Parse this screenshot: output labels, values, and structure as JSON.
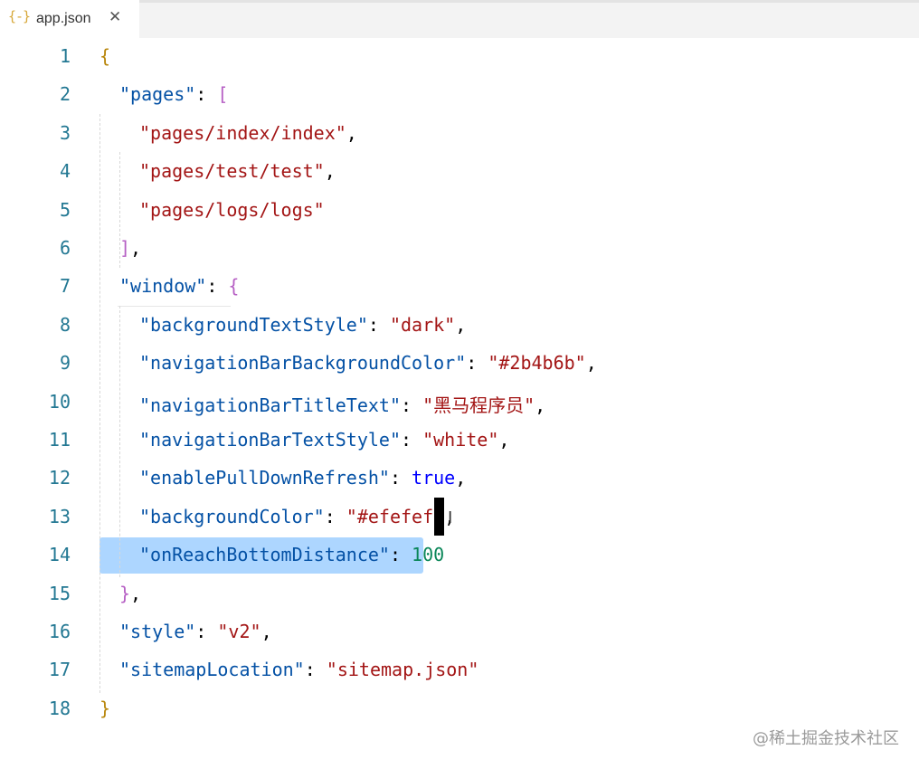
{
  "tab": {
    "icon": "{-}",
    "title": "app.json",
    "close": "✕"
  },
  "watermark": "@稀土掘金技术社区",
  "lines": [
    {
      "n": "1",
      "indent": 0,
      "tokens": [
        {
          "t": "{",
          "c": "brace1"
        }
      ]
    },
    {
      "n": "2",
      "indent": 1,
      "tokens": [
        {
          "t": "\"pages\"",
          "c": "key"
        },
        {
          "t": ": ",
          "c": "punc"
        },
        {
          "t": "[",
          "c": "brace2"
        }
      ]
    },
    {
      "n": "3",
      "indent": 2,
      "tokens": [
        {
          "t": "\"pages/index/index\"",
          "c": "str"
        },
        {
          "t": ",",
          "c": "punc"
        }
      ]
    },
    {
      "n": "4",
      "indent": 2,
      "tokens": [
        {
          "t": "\"pages/test/test\"",
          "c": "str"
        },
        {
          "t": ",",
          "c": "punc"
        }
      ]
    },
    {
      "n": "5",
      "indent": 2,
      "tokens": [
        {
          "t": "\"pages/logs/logs\"",
          "c": "str"
        }
      ]
    },
    {
      "n": "6",
      "indent": 1,
      "tokens": [
        {
          "t": "]",
          "c": "brace2"
        },
        {
          "t": ",",
          "c": "punc"
        }
      ]
    },
    {
      "n": "7",
      "indent": 1,
      "tokens": [
        {
          "t": "\"window\"",
          "c": "key"
        },
        {
          "t": ": ",
          "c": "punc"
        },
        {
          "t": "{",
          "c": "brace2"
        }
      ]
    },
    {
      "n": "8",
      "indent": 2,
      "tokens": [
        {
          "t": "\"backgroundTextStyle\"",
          "c": "key"
        },
        {
          "t": ": ",
          "c": "punc"
        },
        {
          "t": "\"dark\"",
          "c": "str"
        },
        {
          "t": ",",
          "c": "punc"
        }
      ]
    },
    {
      "n": "9",
      "indent": 2,
      "tokens": [
        {
          "t": "\"navigationBarBackgroundColor\"",
          "c": "key"
        },
        {
          "t": ": ",
          "c": "punc"
        },
        {
          "t": "\"#2b4b6b\"",
          "c": "str"
        },
        {
          "t": ",",
          "c": "punc"
        }
      ]
    },
    {
      "n": "10",
      "indent": 2,
      "tokens": [
        {
          "t": "\"navigationBarTitleText\"",
          "c": "key"
        },
        {
          "t": ": ",
          "c": "punc"
        },
        {
          "t": "\"黑马程序员\"",
          "c": "str"
        },
        {
          "t": ",",
          "c": "punc"
        }
      ]
    },
    {
      "n": "11",
      "indent": 2,
      "tokens": [
        {
          "t": "\"navigationBarTextStyle\"",
          "c": "key"
        },
        {
          "t": ": ",
          "c": "punc"
        },
        {
          "t": "\"white\"",
          "c": "str"
        },
        {
          "t": ",",
          "c": "punc"
        }
      ]
    },
    {
      "n": "12",
      "indent": 2,
      "tokens": [
        {
          "t": "\"enablePullDownRefresh\"",
          "c": "key"
        },
        {
          "t": ": ",
          "c": "punc"
        },
        {
          "t": "true",
          "c": "bool"
        },
        {
          "t": ",",
          "c": "punc"
        }
      ]
    },
    {
      "n": "13",
      "indent": 2,
      "tokens": [
        {
          "t": "\"backgroundColor\"",
          "c": "key"
        },
        {
          "t": ": ",
          "c": "punc"
        },
        {
          "t": "\"#efefef\"",
          "c": "str"
        },
        {
          "t": ",",
          "c": "punc"
        }
      ]
    },
    {
      "n": "14",
      "indent": 2,
      "tokens": [
        {
          "t": "\"onReachBottomDistance\"",
          "c": "key"
        },
        {
          "t": ": ",
          "c": "punc"
        },
        {
          "t": "100",
          "c": "num"
        }
      ]
    },
    {
      "n": "15",
      "indent": 1,
      "tokens": [
        {
          "t": "}",
          "c": "brace2"
        },
        {
          "t": ",",
          "c": "punc"
        }
      ]
    },
    {
      "n": "16",
      "indent": 1,
      "tokens": [
        {
          "t": "\"style\"",
          "c": "key"
        },
        {
          "t": ": ",
          "c": "punc"
        },
        {
          "t": "\"v2\"",
          "c": "str"
        },
        {
          "t": ",",
          "c": "punc"
        }
      ]
    },
    {
      "n": "17",
      "indent": 1,
      "tokens": [
        {
          "t": "\"sitemapLocation\"",
          "c": "key"
        },
        {
          "t": ": ",
          "c": "punc"
        },
        {
          "t": "\"sitemap.json\"",
          "c": "str"
        }
      ]
    },
    {
      "n": "18",
      "indent": 0,
      "tokens": [
        {
          "t": "}",
          "c": "brace1"
        }
      ]
    }
  ],
  "colors": {
    "line_number": "#237893",
    "key": "#0451a5",
    "string": "#a31515",
    "number": "#098658",
    "boolean": "#0000ff",
    "brace_outer": "#b8860b",
    "brace_inner": "#b65fc4",
    "selection": "#add6ff"
  }
}
